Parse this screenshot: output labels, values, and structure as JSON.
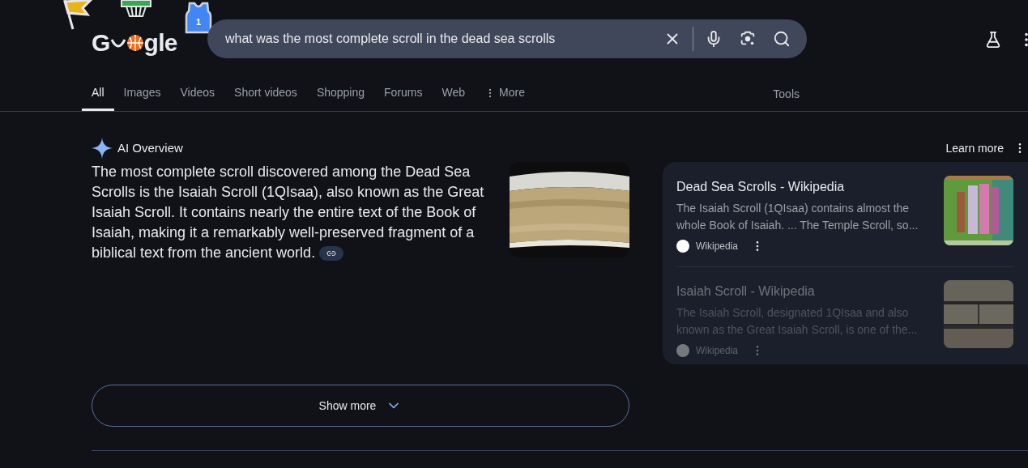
{
  "logo": {
    "lead": "G",
    "tail": "gle",
    "jersey_number": "1"
  },
  "search": {
    "value": "what was the most complete scroll in the dead sea scrolls"
  },
  "tabs": [
    {
      "label": "All",
      "selected": true
    },
    {
      "label": "Images",
      "selected": false
    },
    {
      "label": "Videos",
      "selected": false
    },
    {
      "label": "Short videos",
      "selected": false
    },
    {
      "label": "Shopping",
      "selected": false
    },
    {
      "label": "Forums",
      "selected": false
    },
    {
      "label": "Web",
      "selected": false
    },
    {
      "label": "More",
      "selected": false,
      "kind": "menu"
    }
  ],
  "tools": "Tools",
  "ai_overview": {
    "title": "AI Overview",
    "learn_more": "Learn more",
    "text": "The most complete scroll discovered among the Dead Sea Scrolls is the Isaiah Scroll (1QIsaa), also known as the Great Isaiah Scroll. It contains nearly the entire text of the Book of Isaiah, making it a remarkably well-preserved fragment of a biblical text from the ancient world.",
    "sources": [
      {
        "title": "Dead Sea Scrolls - Wikipedia",
        "snippet": "The Isaiah Scroll (1QIsaa) contains almost the whole Book of Isaiah. ... The Temple Scroll, so...",
        "site": "Wikipedia",
        "faded": false
      },
      {
        "title": "Isaiah Scroll - Wikipedia",
        "snippet": "The Isaiah Scroll, designated 1QIsaa and also known as the Great Isaiah Scroll, is one of the...",
        "site": "Wikipedia",
        "faded": true
      }
    ],
    "show_more": "Show more"
  }
}
